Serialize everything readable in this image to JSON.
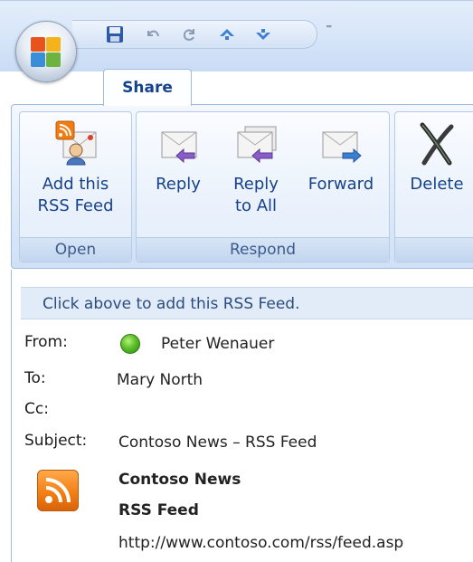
{
  "quick_access": {
    "icons": [
      "save-icon",
      "undo-icon",
      "redo-icon",
      "previous-item-icon",
      "next-item-icon"
    ],
    "customize_glyph": "⁼"
  },
  "tabs": [
    {
      "label": "Share"
    }
  ],
  "ribbon": {
    "groups": [
      {
        "label": "Open",
        "buttons": [
          {
            "label": "Add this\nRSS Feed",
            "icon": "add-rss-feed-icon"
          }
        ]
      },
      {
        "label": "Respond",
        "buttons": [
          {
            "label": "Reply",
            "icon": "reply-icon"
          },
          {
            "label": "Reply\nto All",
            "icon": "reply-all-icon"
          },
          {
            "label": "Forward",
            "icon": "forward-icon"
          }
        ]
      },
      {
        "label": "",
        "buttons": [
          {
            "label": "Delete",
            "icon": "delete-icon"
          }
        ]
      }
    ]
  },
  "message": {
    "info_bar": "Click above to add this RSS Feed.",
    "from_label": "From:",
    "from_value": "Peter Wenauer",
    "to_label": "To:",
    "to_value": "Mary North",
    "cc_label": "Cc:",
    "cc_value": "",
    "subject_label": "Subject:",
    "subject_value": "Contoso News – RSS Feed",
    "feed_name": "Contoso News",
    "feed_type": "RSS Feed",
    "feed_url": "http://www.contoso.com/rss/feed.asp"
  },
  "colors": {
    "ribbon_text": "#15428b",
    "group_label_text": "#3c5a8c",
    "info_bar_bg": "#e1ecf8",
    "rss_orange": "#f07c12",
    "presence_green": "#5cbf2a"
  }
}
